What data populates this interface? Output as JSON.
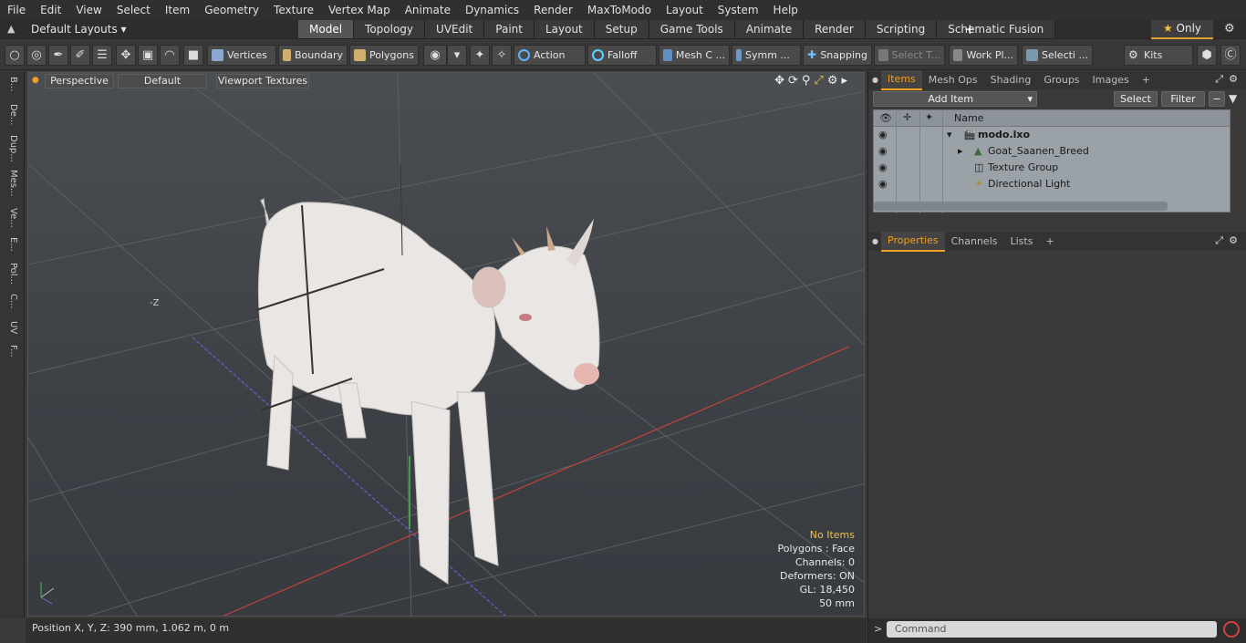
{
  "menu": [
    "File",
    "Edit",
    "View",
    "Select",
    "Item",
    "Geometry",
    "Texture",
    "Vertex Map",
    "Animate",
    "Dynamics",
    "Render",
    "MaxToModo",
    "Layout",
    "System",
    "Help"
  ],
  "layouts": {
    "label": "Default Layouts"
  },
  "mode_tabs": [
    "Model",
    "Topology",
    "UVEdit",
    "Paint",
    "Layout",
    "Setup",
    "Game Tools",
    "Animate",
    "Render",
    "Scripting",
    "Schematic Fusion"
  ],
  "active_tab": "Model",
  "only_label": "Only",
  "toolbar": {
    "vertices": "Vertices",
    "boundary": "Boundary",
    "polygons": "Polygons",
    "action": "Action",
    "falloff": "Falloff",
    "mesh": "Mesh C ...",
    "symm": "Symm ...",
    "snapping": "Snapping",
    "select_t": "Select T...",
    "work": "Work Pl...",
    "selecti": "Selecti ...",
    "kits": "Kits"
  },
  "left_tabs": [
    "B...",
    "De...",
    "Dup...",
    "Mes...",
    "Ve...",
    "E...",
    "Pol...",
    "C...",
    "UV",
    "F..."
  ],
  "viewport": {
    "perspective": "Perspective",
    "default": "Default",
    "textures": "Viewport Textures",
    "axis_label": "-Z"
  },
  "vpinfo": {
    "no_items": "No Items",
    "polygons": "Polygons : Face",
    "channels": "Channels: 0",
    "deformers": "Deformers: ON",
    "gl": "GL: 18,450",
    "mm": "50 mm"
  },
  "status": "Position X, Y, Z:   390 mm, 1.062 m, 0 m",
  "right_tabs_top": [
    "Items",
    "Mesh Ops",
    "Shading",
    "Groups",
    "Images"
  ],
  "items": {
    "add_item": "Add Item",
    "select": "Select",
    "filter": "Filter",
    "name_col": "Name",
    "rows": [
      {
        "label": "modo.lxo"
      },
      {
        "label": "Goat_Saanen_Breed"
      },
      {
        "label": "Texture Group"
      },
      {
        "label": "Directional Light"
      }
    ]
  },
  "right_tabs_bottom": [
    "Properties",
    "Channels",
    "Lists"
  ],
  "command_placeholder": "Command"
}
